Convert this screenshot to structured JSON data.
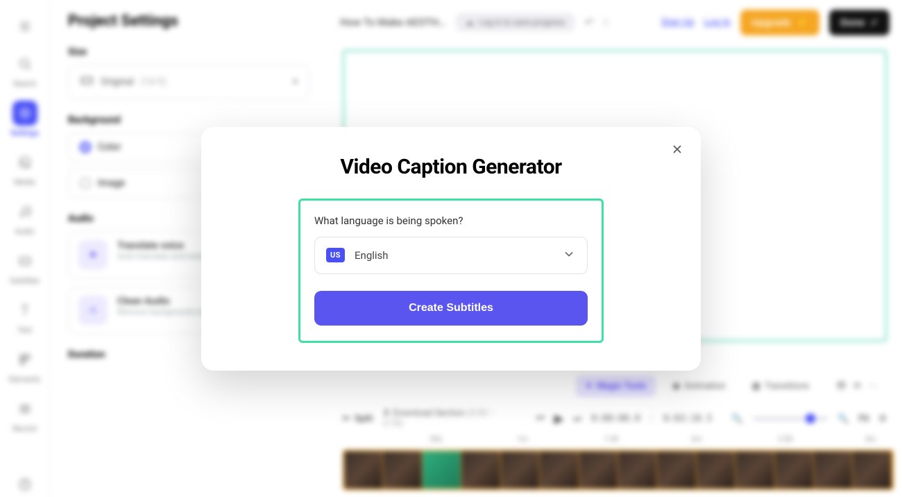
{
  "rail": {
    "items": [
      {
        "label": "Search"
      },
      {
        "label": "Settings"
      },
      {
        "label": "Media"
      },
      {
        "label": "Audio"
      },
      {
        "label": "Subtitles"
      },
      {
        "label": "Text"
      },
      {
        "label": "Elements"
      },
      {
        "label": "Record"
      }
    ]
  },
  "panel": {
    "title": "Project Settings",
    "size_label": "Size",
    "size_value": "Original",
    "size_ratio": "(16:9)",
    "background_label": "Background",
    "bg_color": "Color",
    "bg_image": "Image",
    "audio_label": "Audio",
    "translate_title": "Translate voice",
    "translate_sub": "Auto translate and redub into languages",
    "clean_title": "Clean Audio",
    "clean_sub": "Remove background noise",
    "duration_label": "Duration",
    "split_label": "Split",
    "download_section": "Download Section",
    "download_range": "(0:00 – 3:18)"
  },
  "topbar": {
    "project_name": "How To Make AESTH…",
    "save_hint": "Log in to save progress",
    "undo_count": "0",
    "signup": "Sign Up",
    "login": "Log In",
    "upgrade": "Upgrade",
    "done": "Done"
  },
  "toolstrip": {
    "magic": "Magic Tools",
    "animation": "Animation",
    "transitions": "Transitions"
  },
  "transport": {
    "current": "0:00:00.0",
    "total": "0:03:18.5",
    "fit": "Fit"
  },
  "ruler": {
    "marks": [
      "30s",
      "1m",
      "1:30",
      "2m",
      "2:30",
      "3m"
    ]
  },
  "modal": {
    "title": "Video Caption Generator",
    "question": "What language is being spoken?",
    "flag_code": "US",
    "language": "English",
    "create": "Create Subtitles"
  }
}
